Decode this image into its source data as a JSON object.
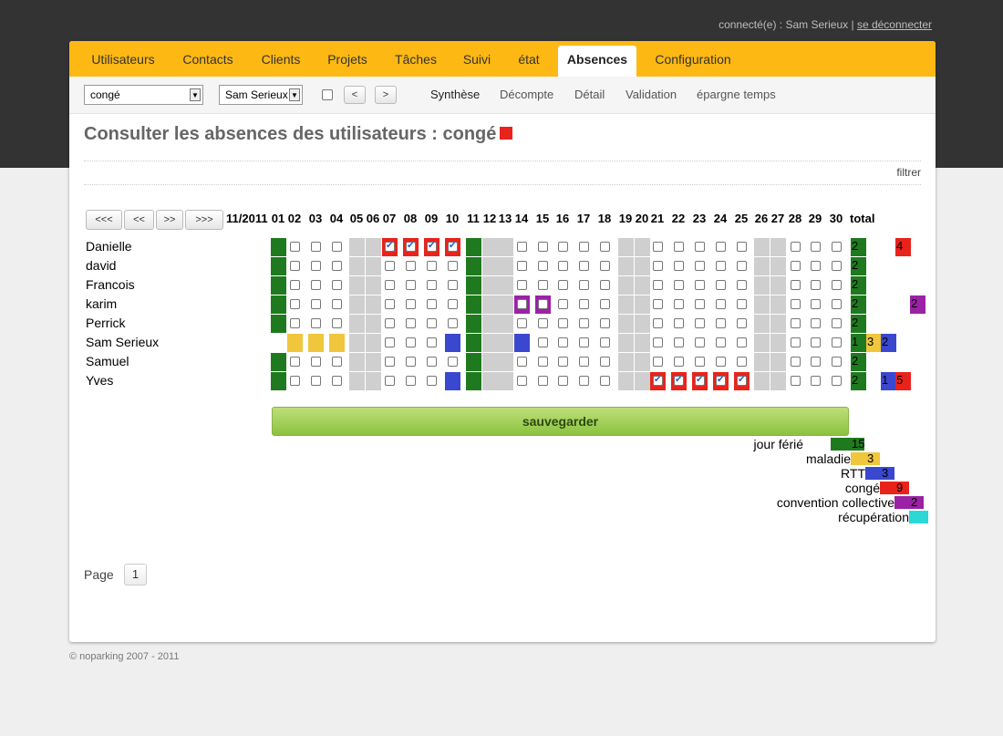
{
  "header": {
    "user_prefix": "connecté(e) : Sam Serieux | ",
    "logout_label": "se déconnecter"
  },
  "nav": {
    "tabs": [
      {
        "label": "Utilisateurs",
        "active": false
      },
      {
        "label": "Contacts",
        "active": false
      },
      {
        "label": "Clients",
        "active": false
      },
      {
        "label": "Projets",
        "active": false
      },
      {
        "label": "Tâches",
        "active": false
      },
      {
        "label": "Suivi",
        "active": false
      },
      {
        "label": "état",
        "active": false
      },
      {
        "label": "Absences",
        "active": true
      },
      {
        "label": "Configuration",
        "active": false
      }
    ]
  },
  "toolbar": {
    "type_select_value": "congé",
    "user_select_value": "Sam Serieux",
    "prev_label": "<",
    "next_label": ">",
    "subtabs": [
      {
        "label": "Synthèse",
        "active": true
      },
      {
        "label": "Décompte",
        "active": false
      },
      {
        "label": "Détail",
        "active": false
      },
      {
        "label": "Validation",
        "active": false
      },
      {
        "label": "épargne temps",
        "active": false
      }
    ]
  },
  "page_title": "Consulter les absences des utilisateurs : congé",
  "filter_label": "filtrer",
  "period_nav": [
    "<<<",
    "<<",
    ">>",
    ">>>"
  ],
  "calendar": {
    "month_label": "11/2011",
    "total_label": "total",
    "days": [
      "01",
      "02",
      "03",
      "04",
      "05",
      "06",
      "07",
      "08",
      "09",
      "10",
      "11",
      "12",
      "13",
      "14",
      "15",
      "16",
      "17",
      "18",
      "19",
      "20",
      "21",
      "22",
      "23",
      "24",
      "25",
      "26",
      "27",
      "28",
      "29",
      "30"
    ],
    "weekend_days": [
      "05",
      "06",
      "12",
      "13",
      "19",
      "20",
      "26",
      "27"
    ],
    "holiday_days": [
      "01",
      "11"
    ],
    "users": [
      {
        "name": "Danielle",
        "absences": {
          "07": "conge",
          "08": "conge",
          "09": "conge",
          "10": "conge"
        },
        "checked": [
          "07",
          "08",
          "09",
          "10"
        ],
        "totals": {
          "ferie": "2",
          "conge": "4"
        }
      },
      {
        "name": "david",
        "absences": {},
        "checked": [],
        "totals": {
          "ferie": "2"
        }
      },
      {
        "name": "Francois",
        "absences": {},
        "checked": [],
        "totals": {
          "ferie": "2"
        }
      },
      {
        "name": "karim",
        "absences": {
          "14": "conv",
          "15": "conv"
        },
        "checked": [],
        "totals": {
          "ferie": "2",
          "conv": "2"
        }
      },
      {
        "name": "Perrick",
        "absences": {},
        "checked": [],
        "totals": {
          "ferie": "2"
        }
      },
      {
        "name": "Sam Serieux",
        "absences": {
          "01": "none",
          "02": "maladie",
          "03": "maladie",
          "04": "maladie",
          "10": "rtt",
          "14": "rtt"
        },
        "checked": [],
        "totals": {
          "ferie": "1",
          "maladie": "3",
          "rtt": "2"
        }
      },
      {
        "name": "Samuel",
        "absences": {},
        "checked": [],
        "totals": {
          "ferie": "2"
        }
      },
      {
        "name": "Yves",
        "absences": {
          "10": "rtt",
          "21": "conge",
          "22": "conge",
          "23": "conge",
          "24": "conge",
          "25": "conge"
        },
        "checked": [
          "21",
          "22",
          "23",
          "24",
          "25"
        ],
        "totals": {
          "ferie": "2",
          "rtt": "1",
          "conge": "5"
        }
      }
    ]
  },
  "save_label": "sauvegarder",
  "legend": [
    {
      "label": "jour férié",
      "key": "ferie",
      "color": "#1f7a1f",
      "count": "15"
    },
    {
      "label": "maladie",
      "key": "maladie",
      "color": "#f0c63c",
      "count": "3"
    },
    {
      "label": "RTT",
      "key": "rtt",
      "color": "#3a47cf",
      "count": "3"
    },
    {
      "label": "congé",
      "key": "conge",
      "color": "#e8231c",
      "count": "9"
    },
    {
      "label": "convention collective",
      "key": "conv",
      "color": "#9b22a5",
      "count": "2"
    },
    {
      "label": "récupération",
      "key": "recup",
      "color": "#2ad8d8",
      "count": ""
    }
  ],
  "pagination": {
    "label": "Page",
    "current": "1"
  },
  "footer": "© noparking 2007 - 2011"
}
